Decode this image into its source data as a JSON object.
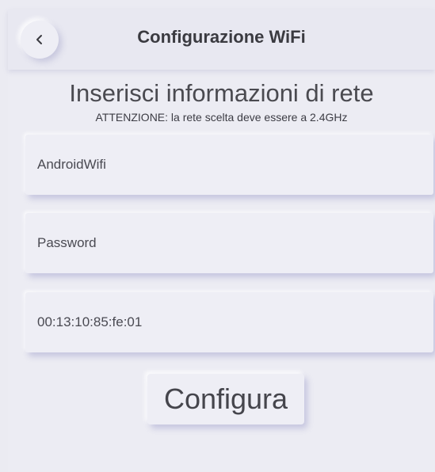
{
  "header": {
    "title": "Configurazione WiFi",
    "back_icon": "chevron-left-icon"
  },
  "form": {
    "heading": "Inserisci informazioni di rete",
    "warning": "ATTENZIONE: la rete scelta deve essere a 2.4GHz",
    "ssid_value": "AndroidWifi",
    "password_placeholder": "Password",
    "mac_value": "00:13:10:85:fe:01",
    "submit_label": "Configura"
  },
  "colors": {
    "background": "#ececf3",
    "text": "#4a4a50"
  }
}
